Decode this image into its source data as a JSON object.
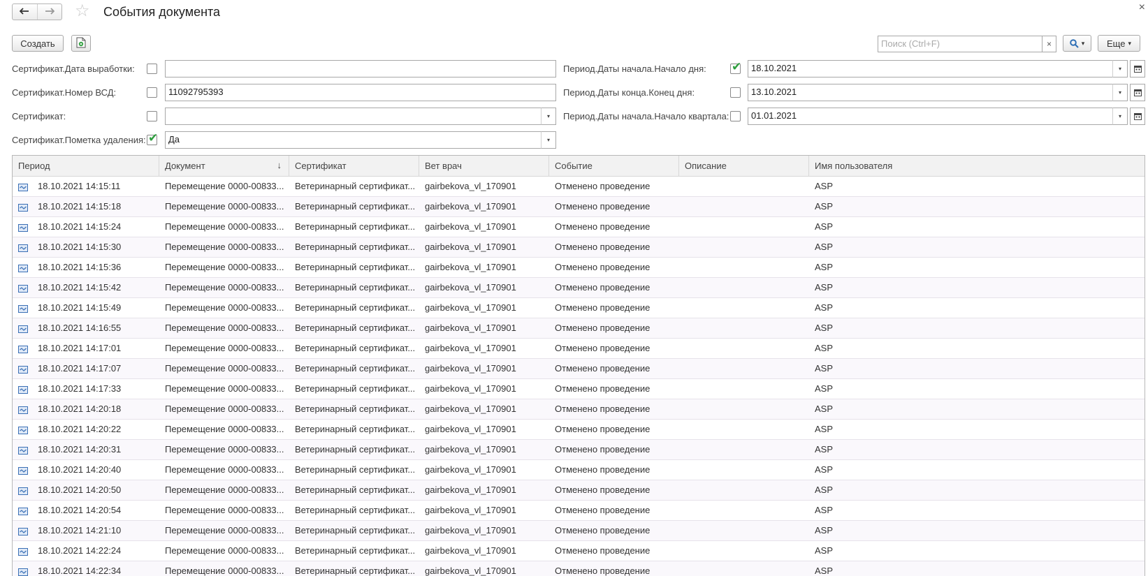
{
  "window": {
    "title": "События документа",
    "back_icon": "arrow-left",
    "forward_icon": "arrow-right",
    "favorite_icon": "star",
    "close_symbol": "×"
  },
  "toolbar": {
    "create_label": "Создать",
    "search_placeholder": "Поиск (Ctrl+F)",
    "search_clear": "×",
    "more_label": "Еще",
    "dropdown_symbol": "▾"
  },
  "filters": {
    "left": [
      {
        "label": "Сертификат.Дата выработки:",
        "checked": false,
        "value": "",
        "has_dropdown": false
      },
      {
        "label": "Сертификат.Номер ВСД:",
        "checked": false,
        "value": "11092795393",
        "has_dropdown": false
      },
      {
        "label": "Сертификат:",
        "checked": false,
        "value": "",
        "has_dropdown": true
      },
      {
        "label": "Сертификат.Пометка удаления:",
        "checked": true,
        "value": "Да",
        "has_dropdown": true
      }
    ],
    "right": [
      {
        "label": "Период.Даты начала.Начало дня:",
        "checked": true,
        "value": "18.10.2021"
      },
      {
        "label": "Период.Даты конца.Конец дня:",
        "checked": false,
        "value": "13.10.2021"
      },
      {
        "label": "Период.Даты начала.Начало квартала:",
        "checked": false,
        "value": "01.01.2021"
      }
    ],
    "checkmark": "✔"
  },
  "table": {
    "columns": [
      "Период",
      "Документ",
      "Сертификат",
      "Вет врач",
      "Событие",
      "Описание",
      "Имя пользователя"
    ],
    "sort_column": "Документ",
    "sort_symbol": "↓",
    "rows": [
      {
        "period": "18.10.2021 14:15:11",
        "document": "Перемещение 0000-00833...",
        "certificate": "Ветеринарный сертификат...",
        "vet": "gairbekova_vl_170901",
        "event": "Отменено проведение",
        "description": "",
        "user": "ASP"
      },
      {
        "period": "18.10.2021 14:15:18",
        "document": "Перемещение 0000-00833...",
        "certificate": "Ветеринарный сертификат...",
        "vet": "gairbekova_vl_170901",
        "event": "Отменено проведение",
        "description": "",
        "user": "ASP"
      },
      {
        "period": "18.10.2021 14:15:24",
        "document": "Перемещение 0000-00833...",
        "certificate": "Ветеринарный сертификат...",
        "vet": "gairbekova_vl_170901",
        "event": "Отменено проведение",
        "description": "",
        "user": "ASP"
      },
      {
        "period": "18.10.2021 14:15:30",
        "document": "Перемещение 0000-00833...",
        "certificate": "Ветеринарный сертификат...",
        "vet": "gairbekova_vl_170901",
        "event": "Отменено проведение",
        "description": "",
        "user": "ASP"
      },
      {
        "period": "18.10.2021 14:15:36",
        "document": "Перемещение 0000-00833...",
        "certificate": "Ветеринарный сертификат...",
        "vet": "gairbekova_vl_170901",
        "event": "Отменено проведение",
        "description": "",
        "user": "ASP"
      },
      {
        "period": "18.10.2021 14:15:42",
        "document": "Перемещение 0000-00833...",
        "certificate": "Ветеринарный сертификат...",
        "vet": "gairbekova_vl_170901",
        "event": "Отменено проведение",
        "description": "",
        "user": "ASP"
      },
      {
        "period": "18.10.2021 14:15:49",
        "document": "Перемещение 0000-00833...",
        "certificate": "Ветеринарный сертификат...",
        "vet": "gairbekova_vl_170901",
        "event": "Отменено проведение",
        "description": "",
        "user": "ASP"
      },
      {
        "period": "18.10.2021 14:16:55",
        "document": "Перемещение 0000-00833...",
        "certificate": "Ветеринарный сертификат...",
        "vet": "gairbekova_vl_170901",
        "event": "Отменено проведение",
        "description": "",
        "user": "ASP"
      },
      {
        "period": "18.10.2021 14:17:01",
        "document": "Перемещение 0000-00833...",
        "certificate": "Ветеринарный сертификат...",
        "vet": "gairbekova_vl_170901",
        "event": "Отменено проведение",
        "description": "",
        "user": "ASP"
      },
      {
        "period": "18.10.2021 14:17:07",
        "document": "Перемещение 0000-00833...",
        "certificate": "Ветеринарный сертификат...",
        "vet": "gairbekova_vl_170901",
        "event": "Отменено проведение",
        "description": "",
        "user": "ASP"
      },
      {
        "period": "18.10.2021 14:17:33",
        "document": "Перемещение 0000-00833...",
        "certificate": "Ветеринарный сертификат...",
        "vet": "gairbekova_vl_170901",
        "event": "Отменено проведение",
        "description": "",
        "user": "ASP"
      },
      {
        "period": "18.10.2021 14:20:18",
        "document": "Перемещение 0000-00833...",
        "certificate": "Ветеринарный сертификат...",
        "vet": "gairbekova_vl_170901",
        "event": "Отменено проведение",
        "description": "",
        "user": "ASP"
      },
      {
        "period": "18.10.2021 14:20:22",
        "document": "Перемещение 0000-00833...",
        "certificate": "Ветеринарный сертификат...",
        "vet": "gairbekova_vl_170901",
        "event": "Отменено проведение",
        "description": "",
        "user": "ASP"
      },
      {
        "period": "18.10.2021 14:20:31",
        "document": "Перемещение 0000-00833...",
        "certificate": "Ветеринарный сертификат...",
        "vet": "gairbekova_vl_170901",
        "event": "Отменено проведение",
        "description": "",
        "user": "ASP"
      },
      {
        "period": "18.10.2021 14:20:40",
        "document": "Перемещение 0000-00833...",
        "certificate": "Ветеринарный сертификат...",
        "vet": "gairbekova_vl_170901",
        "event": "Отменено проведение",
        "description": "",
        "user": "ASP"
      },
      {
        "period": "18.10.2021 14:20:50",
        "document": "Перемещение 0000-00833...",
        "certificate": "Ветеринарный сертификат...",
        "vet": "gairbekova_vl_170901",
        "event": "Отменено проведение",
        "description": "",
        "user": "ASP"
      },
      {
        "period": "18.10.2021 14:20:54",
        "document": "Перемещение 0000-00833...",
        "certificate": "Ветеринарный сертификат...",
        "vet": "gairbekova_vl_170901",
        "event": "Отменено проведение",
        "description": "",
        "user": "ASP"
      },
      {
        "period": "18.10.2021 14:21:10",
        "document": "Перемещение 0000-00833...",
        "certificate": "Ветеринарный сертификат...",
        "vet": "gairbekova_vl_170901",
        "event": "Отменено проведение",
        "description": "",
        "user": "ASP"
      },
      {
        "period": "18.10.2021 14:22:24",
        "document": "Перемещение 0000-00833...",
        "certificate": "Ветеринарный сертификат...",
        "vet": "gairbekova_vl_170901",
        "event": "Отменено проведение",
        "description": "",
        "user": "ASP"
      },
      {
        "period": "18.10.2021 14:22:34",
        "document": "Перемещение 0000-00833...",
        "certificate": "Ветеринарный сертификат...",
        "vet": "gairbekova_vl_170901",
        "event": "Отменено проведение",
        "description": "",
        "user": "ASP"
      }
    ]
  },
  "colors": {
    "check_green": "#2e9e3e",
    "row_icon_blue": "#3a6fb5",
    "search_icon_blue": "#2f6fb5"
  }
}
